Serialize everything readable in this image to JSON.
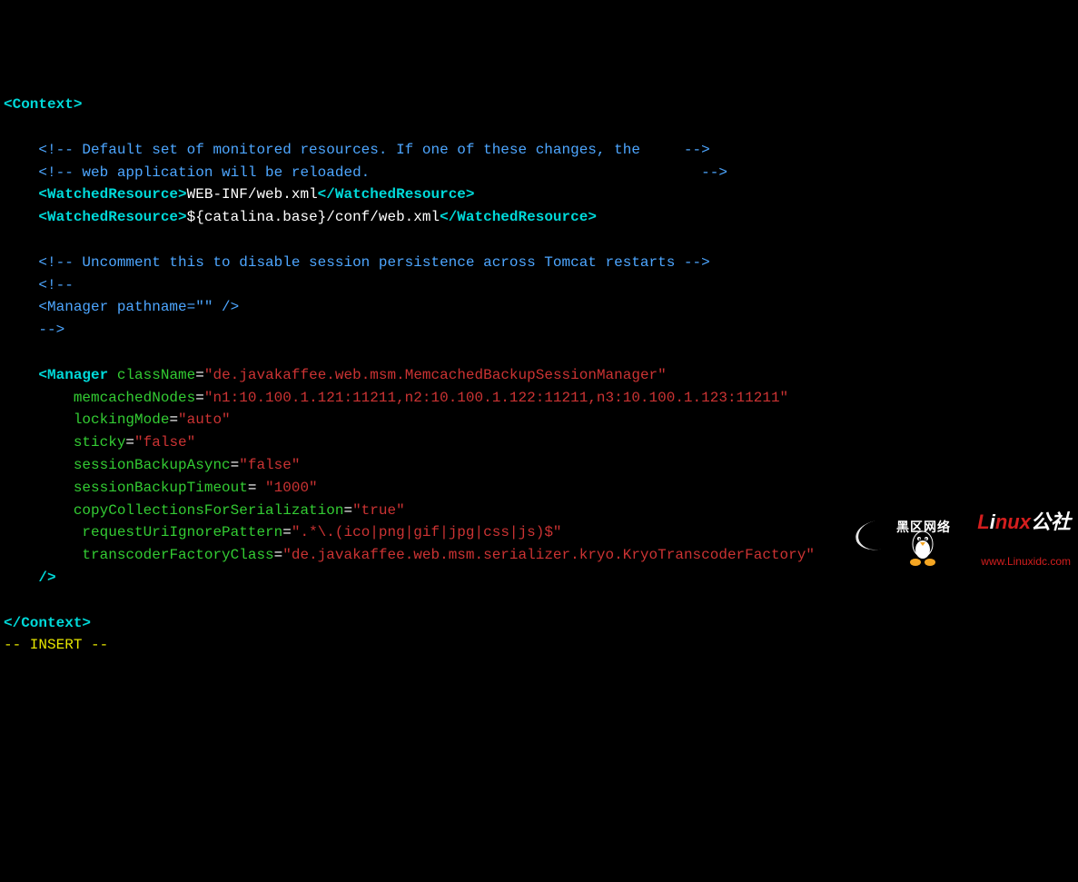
{
  "lines": {
    "l1_open": "<Context>",
    "l2_empty": "",
    "l3_comment": "    <!-- Default set of monitored resources. If one of these changes, the     -->",
    "l4_comment": "    <!-- web application will be reloaded.                                      -->",
    "l5": {
      "indent": "    ",
      "tag_open": "<WatchedResource>",
      "text": "WEB-INF/web.xml",
      "tag_close": "</WatchedResource>"
    },
    "l6": {
      "indent": "    ",
      "tag_open": "<WatchedResource>",
      "text": "${catalina.base}/conf/web.xml",
      "tag_close": "</WatchedResource>"
    },
    "l7_empty": "",
    "l8_comment": "    <!-- Uncomment this to disable session persistence across Tomcat restarts -->",
    "l9_comment": "    <!--",
    "l10_comment": "    <Manager pathname=\"\" />",
    "l11_comment": "    -->",
    "l12_empty": "",
    "l13": {
      "indent": "    ",
      "lt": "<",
      "tag": "Manager",
      "sp": " ",
      "attr": "className",
      "eq": "=",
      "val": "\"de.javakaffee.web.msm.MemcachedBackupSessionManager\""
    },
    "l14": {
      "indent": "        ",
      "attr": "memcachedNodes",
      "eq": "=",
      "val": "\"n1:10.100.1.121:11211,n2:10.100.1.122:11211,n3:10.100.1.123:11211\""
    },
    "l15": {
      "indent": "        ",
      "attr": "lockingMode",
      "eq": "=",
      "val": "\"auto\""
    },
    "l16": {
      "indent": "        ",
      "attr": "sticky",
      "eq": "=",
      "val": "\"false\""
    },
    "l17": {
      "indent": "        ",
      "attr": "sessionBackupAsync",
      "eq": "=",
      "val": "\"false\""
    },
    "l18": {
      "indent": "        ",
      "attr": "sessionBackupTimeout",
      "eq": "= ",
      "val": "\"1000\""
    },
    "l19": {
      "indent": "        ",
      "attr": "copyCollectionsForSerialization",
      "eq": "=",
      "val": "\"true\""
    },
    "l20": {
      "indent": "         ",
      "attr": "requestUriIgnorePattern",
      "eq": "=",
      "val": "\".*\\.(ico|png|gif|jpg|css|js)$\""
    },
    "l21": {
      "indent": "         ",
      "attr": "transcoderFactoryClass",
      "eq": "=",
      "val": "\"de.javakaffee.web.msm.serializer.kryo.KryoTranscoderFactory\""
    },
    "l22": "    />",
    "l23_empty": "",
    "l24_close": "</Context>",
    "l25_mode": "-- INSERT --"
  },
  "logo": {
    "brand_hq": "黑区网络",
    "brand_l": "L",
    "brand_i": "i",
    "brand_nux": "nux",
    "brand_suffix": "公社",
    "url": "www.Linuxidc.com"
  }
}
